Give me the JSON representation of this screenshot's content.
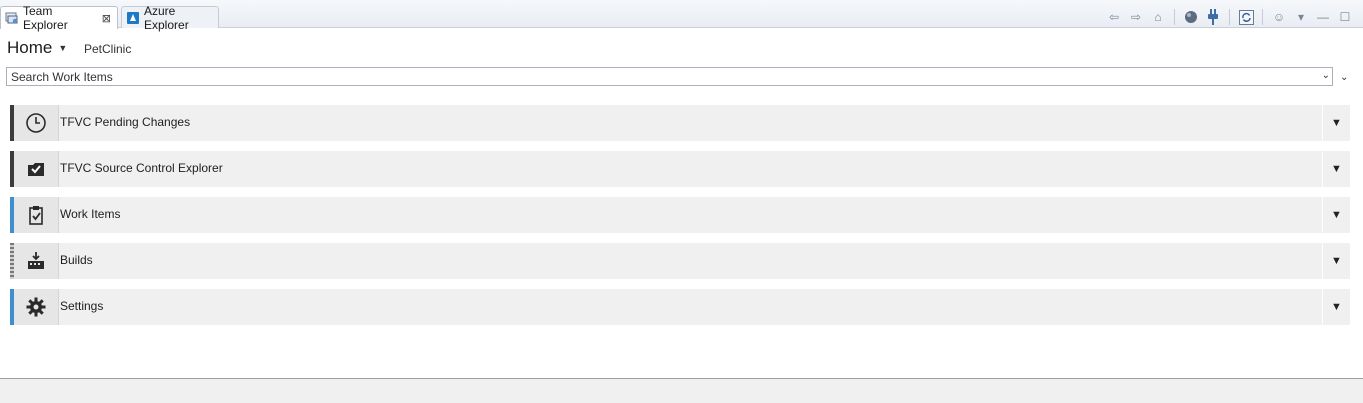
{
  "tabs": [
    {
      "label": "Team Explorer",
      "close": "⊠",
      "active": true
    },
    {
      "label": "Azure Explorer",
      "active": false
    }
  ],
  "toolbar": {
    "back": "⇦",
    "forward": "⇨",
    "home": "⌂",
    "connect": "●",
    "plug": "⚡",
    "refresh": "⟳",
    "smile": "☺",
    "menu": "▾",
    "minimize": "—",
    "maximize": "☐"
  },
  "header": {
    "title": "Home",
    "caret": "▼",
    "project": "PetClinic"
  },
  "search": {
    "placeholder": "Search Work Items",
    "dropdown": "⌄"
  },
  "sections": [
    {
      "label": "TFVC Pending Changes",
      "icon": "clock-icon",
      "accent": "#3c3c3c"
    },
    {
      "label": "TFVC Source Control Explorer",
      "icon": "folder-check-icon",
      "accent": "#3c3c3c"
    },
    {
      "label": "Work Items",
      "icon": "clipboard-check-icon",
      "accent": "#3e8ed0"
    },
    {
      "label": "Builds",
      "icon": "builds-icon",
      "accent": "#7a7a7a"
    },
    {
      "label": "Settings",
      "icon": "gear-icon",
      "accent": "#3e8ed0"
    }
  ],
  "expand_glyph": "▼",
  "colors": {
    "accent_blue": "#3e8ed0",
    "accent_dark": "#3c3c3c",
    "section_bg": "#f0f0f0"
  }
}
